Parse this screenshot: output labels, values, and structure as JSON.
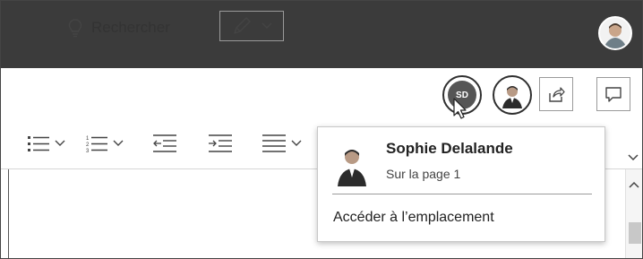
{
  "toolbar": {
    "search_label": "Rechercher",
    "sd_initials": "SD"
  },
  "popup": {
    "name": "Sophie Delalande",
    "location": "Sur la page 1",
    "action_label": "Accéder à l’emplacement"
  },
  "icons": {
    "search": "lightbulb-icon",
    "pen": "pen-icon",
    "share": "share-icon",
    "comment": "comment-icon",
    "bullets": "bullet-list-icon",
    "numbering": "numbered-list-icon",
    "outdent": "decrease-indent-icon",
    "indent": "increase-indent-icon",
    "align": "align-left-icon"
  },
  "colors": {
    "titlebar": "#3b3b3b",
    "sd_badge": "#555555"
  }
}
